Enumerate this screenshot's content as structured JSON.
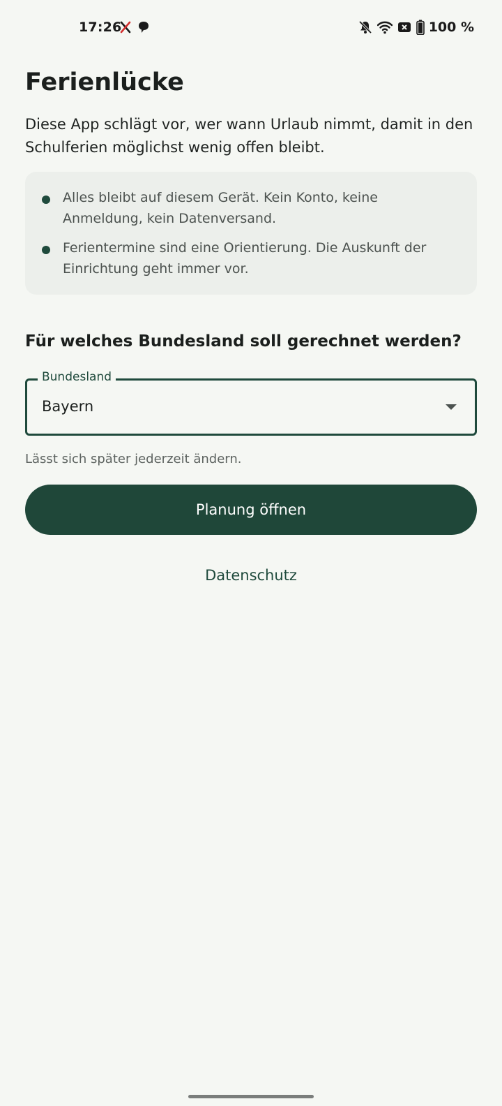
{
  "status_bar": {
    "time": "17:26",
    "battery_text": "100 %",
    "icons": [
      "x-app-icon",
      "chat-bubble-icon",
      "bell-off-icon",
      "wifi-icon",
      "no-sim-icon",
      "battery-icon"
    ]
  },
  "app": {
    "title": "Ferienlücke",
    "intro": "Diese App schlägt vor, wer wann Urlaub nimmt, damit in den Schulferien möglichst wenig offen bleibt.",
    "notices": [
      "Alles bleibt auf diesem Gerät. Kein Konto, keine Anmeldung, kein Datenversand.",
      "Ferientermine sind eine Orientierung. Die Auskunft der Einrichtung geht immer vor."
    ],
    "question": "Für welches Bundesland soll gerechnet werden?",
    "state_select": {
      "label": "Bundesland",
      "value": "Bayern"
    },
    "helper": "Lässt sich später jederzeit ändern.",
    "primary_button": "Planung öffnen",
    "privacy_link": "Datenschutz"
  },
  "colors": {
    "background": "#f5f7f3",
    "accent": "#1f4739",
    "card": "#ecefeb"
  }
}
